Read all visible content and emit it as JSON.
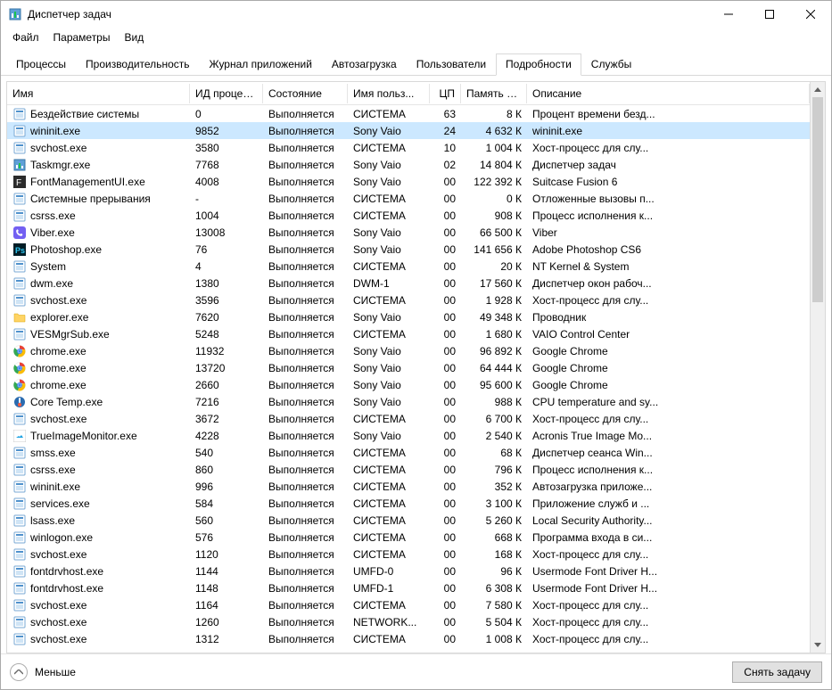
{
  "window": {
    "title": "Диспетчер задач"
  },
  "menu": [
    "Файл",
    "Параметры",
    "Вид"
  ],
  "tabs": [
    "Процессы",
    "Производительность",
    "Журнал приложений",
    "Автозагрузка",
    "Пользователи",
    "Подробности",
    "Службы"
  ],
  "active_tab_index": 5,
  "headers": {
    "name": "Имя",
    "pid": "ИД процес...",
    "state": "Состояние",
    "user": "Имя польз...",
    "cpu": "ЦП",
    "mem": "Память (ч...",
    "desc": "Описание"
  },
  "selected_row_index": 1,
  "footer": {
    "fewer": "Меньше",
    "end_task": "Снять задачу"
  },
  "rows": [
    {
      "icon": "sys",
      "name": "Бездействие системы",
      "pid": "0",
      "state": "Выполняется",
      "user": "СИСТЕМА",
      "cpu": "63",
      "mem": "8 К",
      "desc": "Процент времени безд..."
    },
    {
      "icon": "exe",
      "name": "wininit.exe",
      "pid": "9852",
      "state": "Выполняется",
      "user": "Sony Vaio",
      "cpu": "24",
      "mem": "4 632 К",
      "desc": "wininit.exe"
    },
    {
      "icon": "exe",
      "name": "svchost.exe",
      "pid": "3580",
      "state": "Выполняется",
      "user": "СИСТЕМА",
      "cpu": "10",
      "mem": "1 004 К",
      "desc": "Хост-процесс для слу..."
    },
    {
      "icon": "tm",
      "name": "Taskmgr.exe",
      "pid": "7768",
      "state": "Выполняется",
      "user": "Sony Vaio",
      "cpu": "02",
      "mem": "14 804 К",
      "desc": "Диспетчер задач"
    },
    {
      "icon": "font",
      "name": "FontManagementUI.exe",
      "pid": "4008",
      "state": "Выполняется",
      "user": "Sony Vaio",
      "cpu": "00",
      "mem": "122 392 К",
      "desc": "Suitcase Fusion 6"
    },
    {
      "icon": "sys",
      "name": "Системные прерывания",
      "pid": "-",
      "state": "Выполняется",
      "user": "СИСТЕМА",
      "cpu": "00",
      "mem": "0 К",
      "desc": "Отложенные вызовы п..."
    },
    {
      "icon": "exe",
      "name": "csrss.exe",
      "pid": "1004",
      "state": "Выполняется",
      "user": "СИСТЕМА",
      "cpu": "00",
      "mem": "908 К",
      "desc": "Процесс исполнения к..."
    },
    {
      "icon": "viber",
      "name": "Viber.exe",
      "pid": "13008",
      "state": "Выполняется",
      "user": "Sony Vaio",
      "cpu": "00",
      "mem": "66 500 К",
      "desc": "Viber"
    },
    {
      "icon": "ps",
      "name": "Photoshop.exe",
      "pid": "76",
      "state": "Выполняется",
      "user": "Sony Vaio",
      "cpu": "00",
      "mem": "141 656 К",
      "desc": "Adobe Photoshop CS6"
    },
    {
      "icon": "exe",
      "name": "System",
      "pid": "4",
      "state": "Выполняется",
      "user": "СИСТЕМА",
      "cpu": "00",
      "mem": "20 К",
      "desc": "NT Kernel & System"
    },
    {
      "icon": "exe",
      "name": "dwm.exe",
      "pid": "1380",
      "state": "Выполняется",
      "user": "DWM-1",
      "cpu": "00",
      "mem": "17 560 К",
      "desc": "Диспетчер окон рабоч..."
    },
    {
      "icon": "exe",
      "name": "svchost.exe",
      "pid": "3596",
      "state": "Выполняется",
      "user": "СИСТЕМА",
      "cpu": "00",
      "mem": "1 928 К",
      "desc": "Хост-процесс для слу..."
    },
    {
      "icon": "folder",
      "name": "explorer.exe",
      "pid": "7620",
      "state": "Выполняется",
      "user": "Sony Vaio",
      "cpu": "00",
      "mem": "49 348 К",
      "desc": "Проводник"
    },
    {
      "icon": "exe",
      "name": "VESMgrSub.exe",
      "pid": "5248",
      "state": "Выполняется",
      "user": "СИСТЕМА",
      "cpu": "00",
      "mem": "1 680 К",
      "desc": "VAIO Control Center"
    },
    {
      "icon": "chrome",
      "name": "chrome.exe",
      "pid": "11932",
      "state": "Выполняется",
      "user": "Sony Vaio",
      "cpu": "00",
      "mem": "96 892 К",
      "desc": "Google Chrome"
    },
    {
      "icon": "chrome",
      "name": "chrome.exe",
      "pid": "13720",
      "state": "Выполняется",
      "user": "Sony Vaio",
      "cpu": "00",
      "mem": "64 444 К",
      "desc": "Google Chrome"
    },
    {
      "icon": "chrome",
      "name": "chrome.exe",
      "pid": "2660",
      "state": "Выполняется",
      "user": "Sony Vaio",
      "cpu": "00",
      "mem": "95 600 К",
      "desc": "Google Chrome"
    },
    {
      "icon": "ct",
      "name": "Core Temp.exe",
      "pid": "7216",
      "state": "Выполняется",
      "user": "Sony Vaio",
      "cpu": "00",
      "mem": "988 К",
      "desc": "CPU temperature and sy..."
    },
    {
      "icon": "exe",
      "name": "svchost.exe",
      "pid": "3672",
      "state": "Выполняется",
      "user": "СИСТЕМА",
      "cpu": "00",
      "mem": "6 700 К",
      "desc": "Хост-процесс для слу..."
    },
    {
      "icon": "ti",
      "name": "TrueImageMonitor.exe",
      "pid": "4228",
      "state": "Выполняется",
      "user": "Sony Vaio",
      "cpu": "00",
      "mem": "2 540 К",
      "desc": "Acronis True Image Mo..."
    },
    {
      "icon": "exe",
      "name": "smss.exe",
      "pid": "540",
      "state": "Выполняется",
      "user": "СИСТЕМА",
      "cpu": "00",
      "mem": "68 К",
      "desc": "Диспетчер сеанса  Win..."
    },
    {
      "icon": "exe",
      "name": "csrss.exe",
      "pid": "860",
      "state": "Выполняется",
      "user": "СИСТЕМА",
      "cpu": "00",
      "mem": "796 К",
      "desc": "Процесс исполнения к..."
    },
    {
      "icon": "exe",
      "name": "wininit.exe",
      "pid": "996",
      "state": "Выполняется",
      "user": "СИСТЕМА",
      "cpu": "00",
      "mem": "352 К",
      "desc": "Автозагрузка приложе..."
    },
    {
      "icon": "exe",
      "name": "services.exe",
      "pid": "584",
      "state": "Выполняется",
      "user": "СИСТЕМА",
      "cpu": "00",
      "mem": "3 100 К",
      "desc": "Приложение служб и ..."
    },
    {
      "icon": "exe",
      "name": "lsass.exe",
      "pid": "560",
      "state": "Выполняется",
      "user": "СИСТЕМА",
      "cpu": "00",
      "mem": "5 260 К",
      "desc": "Local Security Authority..."
    },
    {
      "icon": "exe",
      "name": "winlogon.exe",
      "pid": "576",
      "state": "Выполняется",
      "user": "СИСТЕМА",
      "cpu": "00",
      "mem": "668 К",
      "desc": "Программа входа в си..."
    },
    {
      "icon": "exe",
      "name": "svchost.exe",
      "pid": "1120",
      "state": "Выполняется",
      "user": "СИСТЕМА",
      "cpu": "00",
      "mem": "168 К",
      "desc": "Хост-процесс для слу..."
    },
    {
      "icon": "exe",
      "name": "fontdrvhost.exe",
      "pid": "1144",
      "state": "Выполняется",
      "user": "UMFD-0",
      "cpu": "00",
      "mem": "96 К",
      "desc": "Usermode Font Driver H..."
    },
    {
      "icon": "exe",
      "name": "fontdrvhost.exe",
      "pid": "1148",
      "state": "Выполняется",
      "user": "UMFD-1",
      "cpu": "00",
      "mem": "6 308 К",
      "desc": "Usermode Font Driver H..."
    },
    {
      "icon": "exe",
      "name": "svchost.exe",
      "pid": "1164",
      "state": "Выполняется",
      "user": "СИСТЕМА",
      "cpu": "00",
      "mem": "7 580 К",
      "desc": "Хост-процесс для слу..."
    },
    {
      "icon": "exe",
      "name": "svchost.exe",
      "pid": "1260",
      "state": "Выполняется",
      "user": "NETWORK...",
      "cpu": "00",
      "mem": "5 504 К",
      "desc": "Хост-процесс для слу..."
    },
    {
      "icon": "exe",
      "name": "svchost.exe",
      "pid": "1312",
      "state": "Выполняется",
      "user": "СИСТЕМА",
      "cpu": "00",
      "mem": "1 008 К",
      "desc": "Хост-процесс для слу..."
    }
  ]
}
